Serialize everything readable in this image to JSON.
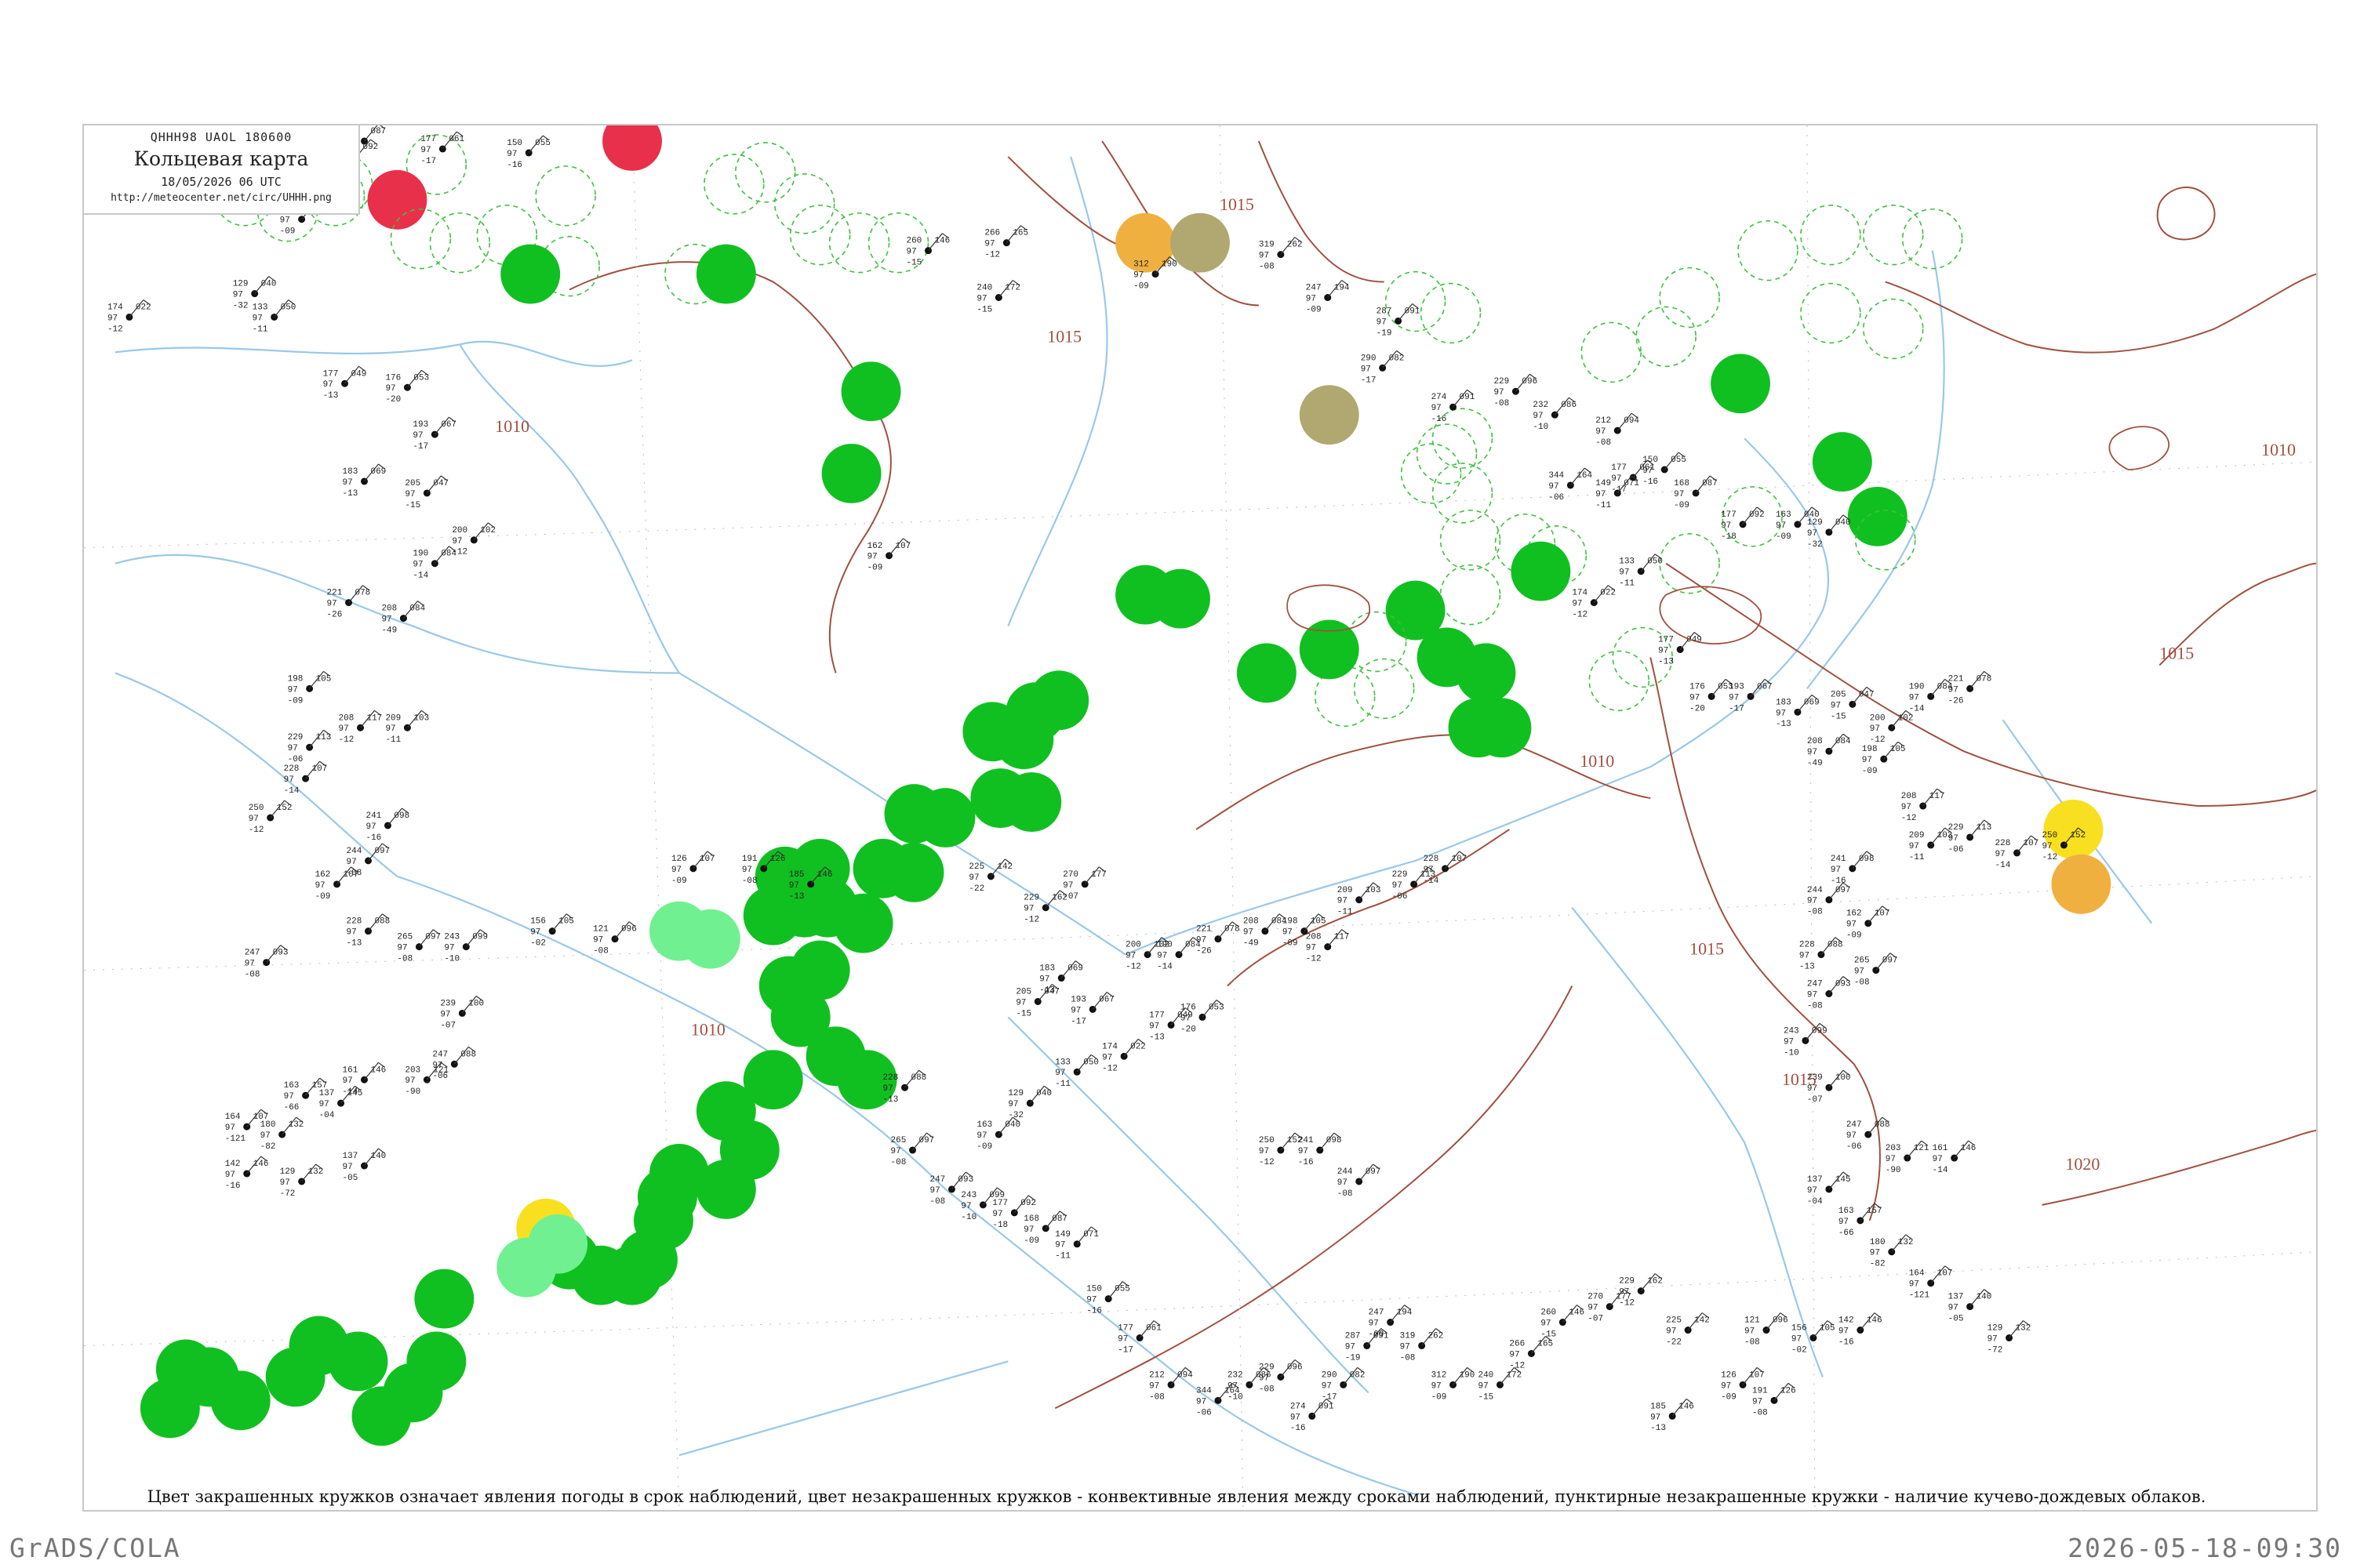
{
  "header": {
    "code": "QHHH98  UAOL  180600",
    "title": "Кольцевая карта",
    "date": "18/05/2026 06 UTC",
    "url": "http://meteocenter.net/circ/UHHH.png"
  },
  "legend_caption": "Цвет закрашенных кружков означает явления погоды в срок наблюдений, цвет незакрашенных кружков - конвективные явления между сроками наблюдений, пунктирные незакрашенные кружки - наличие кучево-дождевых облаков.",
  "footer": {
    "left": "GrADS/COLA",
    "right": "2026-05-18-09:30"
  },
  "isobar_labels": [
    "1015",
    "1015",
    "1010",
    "1010",
    "1015",
    "1010",
    "1010",
    "1015",
    "1015",
    "1020"
  ],
  "colors": {
    "rain": "#10c020",
    "showers_light": "#70f090",
    "thunder": "#e8304a",
    "fog": "#f8e020",
    "haze": "#f0b040",
    "dust": "#b0a870",
    "cb_dashed": "#40c040",
    "isobar": "#a05040",
    "river": "#9ac8e8"
  },
  "stations": [
    {
      "t": "177",
      "p": "061",
      "d": "-17"
    },
    {
      "t": "150",
      "p": "055",
      "d": "-16"
    },
    {
      "t": "149",
      "p": "071",
      "d": "-11"
    },
    {
      "t": "168",
      "p": "087",
      "d": "-09"
    },
    {
      "t": "177",
      "p": "092",
      "d": "-18"
    },
    {
      "t": "163",
      "p": "040",
      "d": "-09"
    },
    {
      "t": "129",
      "p": "040",
      "d": "-32"
    },
    {
      "t": "133",
      "p": "050",
      "d": "-11"
    },
    {
      "t": "174",
      "p": "022",
      "d": "-12"
    },
    {
      "t": "177",
      "p": "049",
      "d": "-13"
    },
    {
      "t": "176",
      "p": "053",
      "d": "-20"
    },
    {
      "t": "193",
      "p": "067",
      "d": "-17"
    },
    {
      "t": "183",
      "p": "069",
      "d": "-13"
    },
    {
      "t": "205",
      "p": "047",
      "d": "-15"
    },
    {
      "t": "200",
      "p": "102",
      "d": "-12"
    },
    {
      "t": "190",
      "p": "084",
      "d": "-14"
    },
    {
      "t": "221",
      "p": "078",
      "d": "-26"
    },
    {
      "t": "208",
      "p": "084",
      "d": "-49"
    },
    {
      "t": "198",
      "p": "105",
      "d": "-09"
    },
    {
      "t": "208",
      "p": "117",
      "d": "-12"
    },
    {
      "t": "209",
      "p": "103",
      "d": "-11"
    },
    {
      "t": "229",
      "p": "113",
      "d": "-06"
    },
    {
      "t": "228",
      "p": "107",
      "d": "-14"
    },
    {
      "t": "250",
      "p": "152",
      "d": "-12"
    },
    {
      "t": "241",
      "p": "098",
      "d": "-16"
    },
    {
      "t": "244",
      "p": "097",
      "d": "-08"
    },
    {
      "t": "162",
      "p": "107",
      "d": "-09"
    },
    {
      "t": "228",
      "p": "088",
      "d": "-13"
    },
    {
      "t": "265",
      "p": "097",
      "d": "-08"
    },
    {
      "t": "247",
      "p": "093",
      "d": "-08"
    },
    {
      "t": "243",
      "p": "099",
      "d": "-10"
    },
    {
      "t": "239",
      "p": "100",
      "d": "-07"
    },
    {
      "t": "247",
      "p": "088",
      "d": "-06"
    },
    {
      "t": "203",
      "p": "121",
      "d": "-90"
    },
    {
      "t": "161",
      "p": "146",
      "d": "-14"
    },
    {
      "t": "137",
      "p": "145",
      "d": "-04"
    },
    {
      "t": "163",
      "p": "157",
      "d": "-66"
    },
    {
      "t": "180",
      "p": "132",
      "d": "-82"
    },
    {
      "t": "164",
      "p": "107",
      "d": "-121"
    },
    {
      "t": "137",
      "p": "140",
      "d": "-05"
    },
    {
      "t": "129",
      "p": "132",
      "d": "-72"
    },
    {
      "t": "142",
      "p": "146",
      "d": "-16"
    },
    {
      "t": "156",
      "p": "105",
      "d": "-02"
    },
    {
      "t": "121",
      "p": "096",
      "d": "-08"
    },
    {
      "t": "126",
      "p": "107",
      "d": "-09"
    },
    {
      "t": "191",
      "p": "126",
      "d": "-08"
    },
    {
      "t": "185",
      "p": "146",
      "d": "-13"
    },
    {
      "t": "225",
      "p": "142",
      "d": "-22"
    },
    {
      "t": "229",
      "p": "162",
      "d": "-12"
    },
    {
      "t": "270",
      "p": "177",
      "d": "-07"
    },
    {
      "t": "260",
      "p": "146",
      "d": "-15"
    },
    {
      "t": "266",
      "p": "165",
      "d": "-12"
    },
    {
      "t": "240",
      "p": "172",
      "d": "-15"
    },
    {
      "t": "312",
      "p": "190",
      "d": "-09"
    },
    {
      "t": "319",
      "p": "262",
      "d": "-08"
    },
    {
      "t": "247",
      "p": "194",
      "d": "-09"
    },
    {
      "t": "287",
      "p": "091",
      "d": "-19"
    },
    {
      "t": "290",
      "p": "082",
      "d": "-17"
    },
    {
      "t": "274",
      "p": "091",
      "d": "-16"
    },
    {
      "t": "229",
      "p": "096",
      "d": "-08"
    },
    {
      "t": "232",
      "p": "086",
      "d": "-10"
    },
    {
      "t": "344",
      "p": "164",
      "d": "-06"
    },
    {
      "t": "212",
      "p": "094",
      "d": "-08"
    }
  ]
}
